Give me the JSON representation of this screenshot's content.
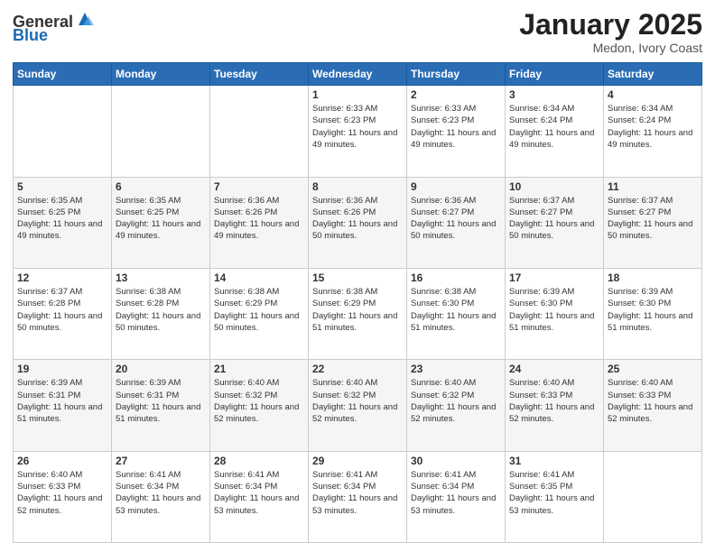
{
  "logo": {
    "general": "General",
    "blue": "Blue"
  },
  "header": {
    "month": "January 2025",
    "location": "Medon, Ivory Coast"
  },
  "days_of_week": [
    "Sunday",
    "Monday",
    "Tuesday",
    "Wednesday",
    "Thursday",
    "Friday",
    "Saturday"
  ],
  "weeks": [
    [
      {
        "day": "",
        "info": ""
      },
      {
        "day": "",
        "info": ""
      },
      {
        "day": "",
        "info": ""
      },
      {
        "day": "1",
        "info": "Sunrise: 6:33 AM\nSunset: 6:23 PM\nDaylight: 11 hours and 49 minutes."
      },
      {
        "day": "2",
        "info": "Sunrise: 6:33 AM\nSunset: 6:23 PM\nDaylight: 11 hours and 49 minutes."
      },
      {
        "day": "3",
        "info": "Sunrise: 6:34 AM\nSunset: 6:24 PM\nDaylight: 11 hours and 49 minutes."
      },
      {
        "day": "4",
        "info": "Sunrise: 6:34 AM\nSunset: 6:24 PM\nDaylight: 11 hours and 49 minutes."
      }
    ],
    [
      {
        "day": "5",
        "info": "Sunrise: 6:35 AM\nSunset: 6:25 PM\nDaylight: 11 hours and 49 minutes."
      },
      {
        "day": "6",
        "info": "Sunrise: 6:35 AM\nSunset: 6:25 PM\nDaylight: 11 hours and 49 minutes."
      },
      {
        "day": "7",
        "info": "Sunrise: 6:36 AM\nSunset: 6:26 PM\nDaylight: 11 hours and 49 minutes."
      },
      {
        "day": "8",
        "info": "Sunrise: 6:36 AM\nSunset: 6:26 PM\nDaylight: 11 hours and 50 minutes."
      },
      {
        "day": "9",
        "info": "Sunrise: 6:36 AM\nSunset: 6:27 PM\nDaylight: 11 hours and 50 minutes."
      },
      {
        "day": "10",
        "info": "Sunrise: 6:37 AM\nSunset: 6:27 PM\nDaylight: 11 hours and 50 minutes."
      },
      {
        "day": "11",
        "info": "Sunrise: 6:37 AM\nSunset: 6:27 PM\nDaylight: 11 hours and 50 minutes."
      }
    ],
    [
      {
        "day": "12",
        "info": "Sunrise: 6:37 AM\nSunset: 6:28 PM\nDaylight: 11 hours and 50 minutes."
      },
      {
        "day": "13",
        "info": "Sunrise: 6:38 AM\nSunset: 6:28 PM\nDaylight: 11 hours and 50 minutes."
      },
      {
        "day": "14",
        "info": "Sunrise: 6:38 AM\nSunset: 6:29 PM\nDaylight: 11 hours and 50 minutes."
      },
      {
        "day": "15",
        "info": "Sunrise: 6:38 AM\nSunset: 6:29 PM\nDaylight: 11 hours and 51 minutes."
      },
      {
        "day": "16",
        "info": "Sunrise: 6:38 AM\nSunset: 6:30 PM\nDaylight: 11 hours and 51 minutes."
      },
      {
        "day": "17",
        "info": "Sunrise: 6:39 AM\nSunset: 6:30 PM\nDaylight: 11 hours and 51 minutes."
      },
      {
        "day": "18",
        "info": "Sunrise: 6:39 AM\nSunset: 6:30 PM\nDaylight: 11 hours and 51 minutes."
      }
    ],
    [
      {
        "day": "19",
        "info": "Sunrise: 6:39 AM\nSunset: 6:31 PM\nDaylight: 11 hours and 51 minutes."
      },
      {
        "day": "20",
        "info": "Sunrise: 6:39 AM\nSunset: 6:31 PM\nDaylight: 11 hours and 51 minutes."
      },
      {
        "day": "21",
        "info": "Sunrise: 6:40 AM\nSunset: 6:32 PM\nDaylight: 11 hours and 52 minutes."
      },
      {
        "day": "22",
        "info": "Sunrise: 6:40 AM\nSunset: 6:32 PM\nDaylight: 11 hours and 52 minutes."
      },
      {
        "day": "23",
        "info": "Sunrise: 6:40 AM\nSunset: 6:32 PM\nDaylight: 11 hours and 52 minutes."
      },
      {
        "day": "24",
        "info": "Sunrise: 6:40 AM\nSunset: 6:33 PM\nDaylight: 11 hours and 52 minutes."
      },
      {
        "day": "25",
        "info": "Sunrise: 6:40 AM\nSunset: 6:33 PM\nDaylight: 11 hours and 52 minutes."
      }
    ],
    [
      {
        "day": "26",
        "info": "Sunrise: 6:40 AM\nSunset: 6:33 PM\nDaylight: 11 hours and 52 minutes."
      },
      {
        "day": "27",
        "info": "Sunrise: 6:41 AM\nSunset: 6:34 PM\nDaylight: 11 hours and 53 minutes."
      },
      {
        "day": "28",
        "info": "Sunrise: 6:41 AM\nSunset: 6:34 PM\nDaylight: 11 hours and 53 minutes."
      },
      {
        "day": "29",
        "info": "Sunrise: 6:41 AM\nSunset: 6:34 PM\nDaylight: 11 hours and 53 minutes."
      },
      {
        "day": "30",
        "info": "Sunrise: 6:41 AM\nSunset: 6:34 PM\nDaylight: 11 hours and 53 minutes."
      },
      {
        "day": "31",
        "info": "Sunrise: 6:41 AM\nSunset: 6:35 PM\nDaylight: 11 hours and 53 minutes."
      },
      {
        "day": "",
        "info": ""
      }
    ]
  ]
}
